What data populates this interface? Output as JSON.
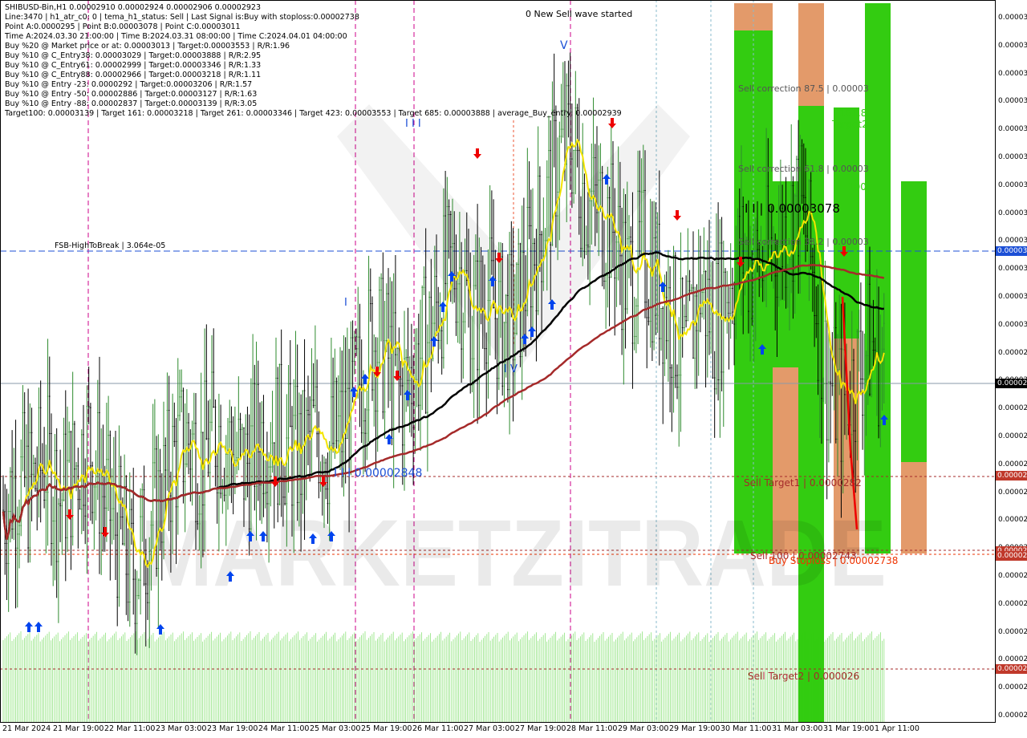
{
  "header": {
    "symbol_line": "SHIBUSD-Bin,H1  0.00002910 0.00002924 0.00002906 0.00002923",
    "info_lines": [
      "Line:3470  |  h1_atr_c0: 0  |  tema_h1_status: Sell  |  Last Signal is:Buy with stoploss:0.00002738",
      "Point A:0.0000295  |  Point B:0.00003078  |  Point C:0.00003011",
      "Time A:2024.03.30 21:00:00  |  Time B:2024.03.31 08:00:00  |  Time C:2024.04.01 04:00:00",
      "Buy %20 @ Market price or at: 0.00003013  |  Target:0.00003553  |  R/R:1.96",
      "Buy %10 @ C_Entry38: 0.00003029  |  Target:0.00003888  |  R/R:2.95",
      "Buy %10 @ C_Entry61: 0.00002999  |  Target:0.00003346  |  R/R:1.33",
      "Buy %10 @ C_Entry88: 0.00002966  |  Target:0.00003218  |  R/R:1.11",
      "Buy %10 @ Entry -23: 0.0000292  |  Target:0.00003206  |  R/R:1.57",
      "Buy %10 @ Entry -50: 0.00002886  |  Target:0.00003127  |  R/R:1.63",
      "Buy %10 @ Entry -88: 0.00002837  |  Target:0.00003139  |  R/R:3.05",
      "Target100: 0.00003139  |  Target 161: 0.00003218  |  Target 261: 0.00003346  |  Target 423: 0.00003553  |  Target 685: 0.00003888  |  average_Buy_entry: 0.00002939"
    ]
  },
  "wave_note": "0 New Sell wave started",
  "labels": {
    "fsb": "FSB-HighToBreak  |  3.064e-05",
    "wave_v": "V",
    "wave_iii": "I I I",
    "wave_iv": "I V",
    "wave_i": "I",
    "wave_iii_price": "I I I 0.00002848",
    "point_iii_price": "I I | 0.00003078",
    "sell_corr_875": "Sell correction 87.5 | 0.00003",
    "sell_corr_618": "Sell correction 61.8 | 0.00003",
    "sell_corr_382": "Sell correction 38.2 | 0.00003",
    "target_1618": "161.8",
    "target2": "Target2",
    "target_100": "100",
    "sell_target1": "Sell Target1 | 0.0000282",
    "sell_100": "Sell 100 | 0.00002743",
    "buy_stoploss": "Buy Stoploss | 0.00002738",
    "sell_target2": "Sell Target2 | 0.000026",
    "watermark": "MARKETZITRADE"
  },
  "price_axis": [
    "0.00003",
    "0.00003",
    "0.00003",
    "0.00003",
    "0.00003",
    "0.00003",
    "0.00003",
    "0.00003",
    "0.00003",
    "0.00003",
    "0.00003",
    "0.00003",
    "0.00002",
    "0.00002",
    "0.00002",
    "0.00002",
    "0.00002",
    "0.00002",
    "0.00002",
    "0.00002",
    "0.00002",
    "0.00002",
    "0.00002",
    "0.00002",
    "0.00002",
    "0.00002"
  ],
  "price_badges": [
    {
      "text": "0.00003",
      "color": "#1c4fd6"
    },
    {
      "text": "0.00002",
      "color": "#000000"
    },
    {
      "text": "0.00002",
      "color": "#c0392b"
    },
    {
      "text": "0.00002",
      "color": "#c0392b"
    },
    {
      "text": "0.00002",
      "color": "#c0392b"
    },
    {
      "text": "0.00002",
      "color": "#c0392b"
    }
  ],
  "time_axis": [
    "21 Mar 2024",
    "21 Mar 19:00",
    "22 Mar 11:00",
    "23 Mar 03:00",
    "23 Mar 19:00",
    "24 Mar 11:00",
    "25 Mar 03:00",
    "25 Mar 19:00",
    "26 Mar 11:00",
    "27 Mar 03:00",
    "27 Mar 19:00",
    "28 Mar 11:00",
    "29 Mar 03:00",
    "29 Mar 19:00",
    "30 Mar 11:00",
    "31 Mar 03:00",
    "31 Mar 19:00",
    "1 Apr 11:00"
  ],
  "colors": {
    "bull": "#2e8b2e",
    "bear": "#000000",
    "ema_fast": "#ffee00",
    "ma_slow": "#000000",
    "ma_red": "#a52a2a",
    "zone_green": "#33cc11",
    "zone_orange": "#e39a6a",
    "level_blue": "#1c4fd6",
    "buy_arrow": "#0044ee",
    "sell_arrow": "#ee0000",
    "vline_magenta": "#cc0088"
  },
  "chart_data": {
    "type": "candlestick",
    "symbol": "SHIBUSD-Bin",
    "timeframe": "H1",
    "ohlc_last": {
      "open": 2.91e-05,
      "high": 2.924e-05,
      "low": 2.906e-05,
      "close": 2.923e-05
    },
    "close_path": [
      2.78e-05,
      2.81e-05,
      2.8e-05,
      2.83e-05,
      2.79e-05,
      2.82e-05,
      2.85e-05,
      2.8e-05,
      2.76e-05,
      2.72e-05,
      2.75e-05,
      2.79e-05,
      2.83e-05,
      2.85e-05,
      2.83e-05,
      2.86e-05,
      2.84e-05,
      2.82e-05,
      2.85e-05,
      2.86e-05,
      2.84e-05,
      2.83e-05,
      2.86e-05,
      2.84e-05,
      2.86e-05,
      2.9e-05,
      2.95e-05,
      2.93e-05,
      2.89e-05,
      2.92e-05,
      2.95e-05,
      3e-05,
      3.02e-05,
      2.96e-05,
      2.99e-05,
      2.96e-05,
      2.96e-05,
      3.02e-05,
      3.06e-05,
      3.12e-05,
      3.14e-05,
      3.08e-05,
      3.07e-05,
      3.05e-05,
      3e-05,
      3.03e-05,
      3e-05,
      2.97e-05,
      2.92e-05,
      3e-05,
      2.96e-05,
      3e-05,
      3.03e-05,
      3.01e-05,
      3.03e-05,
      3.05e-05,
      3.08e-05,
      3.01e-05,
      2.91e-05,
      2.88e-05,
      2.91e-05,
      2.94e-05,
      2.92e-05
    ],
    "levels": [
      {
        "name": "FSB-HighToBreak",
        "value": 3.064e-05
      },
      {
        "name": "Sell Target1",
        "value": 2.82e-05
      },
      {
        "name": "Sell 100",
        "value": 2.743e-05
      },
      {
        "name": "Buy Stoploss",
        "value": 2.738e-05
      },
      {
        "name": "Sell Target2",
        "value": 2.6e-05
      },
      {
        "name": "III",
        "value": 2.848e-05
      },
      {
        "name": "Point B",
        "value": 3.078e-05
      }
    ]
  }
}
